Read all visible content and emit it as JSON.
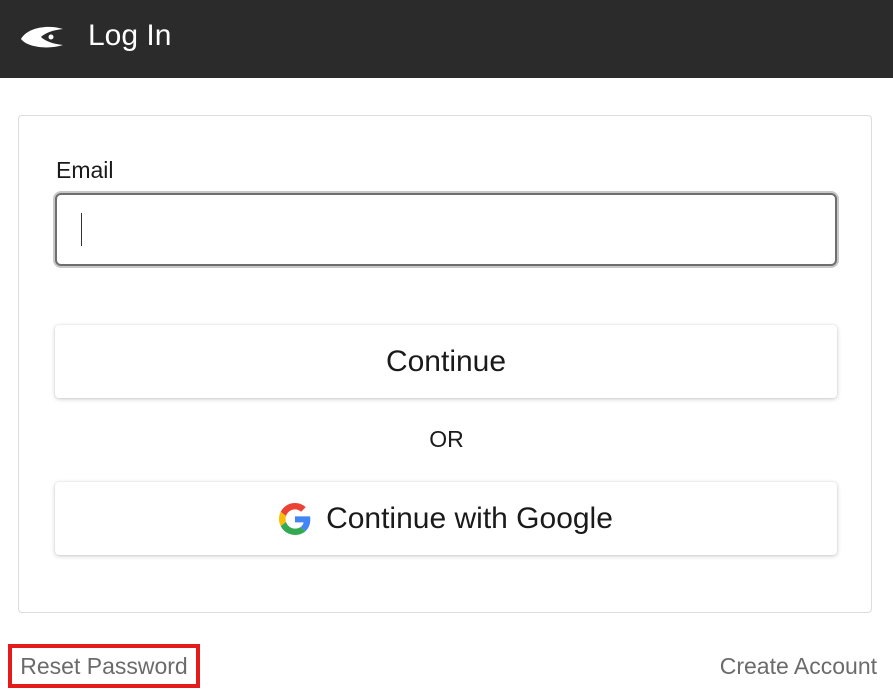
{
  "header": {
    "logo_icon": "app-logo-icon",
    "title": "Log In",
    "background_color": "#2b2b2b"
  },
  "form": {
    "email_label": "Email",
    "email_value": "",
    "continue_label": "Continue",
    "or_text": "OR",
    "google_label": "Continue with Google",
    "google_icon": "google-g-icon"
  },
  "footer": {
    "reset_password": "Reset Password",
    "create_account": "Create Account",
    "highlight_color": "#e31b1b"
  }
}
